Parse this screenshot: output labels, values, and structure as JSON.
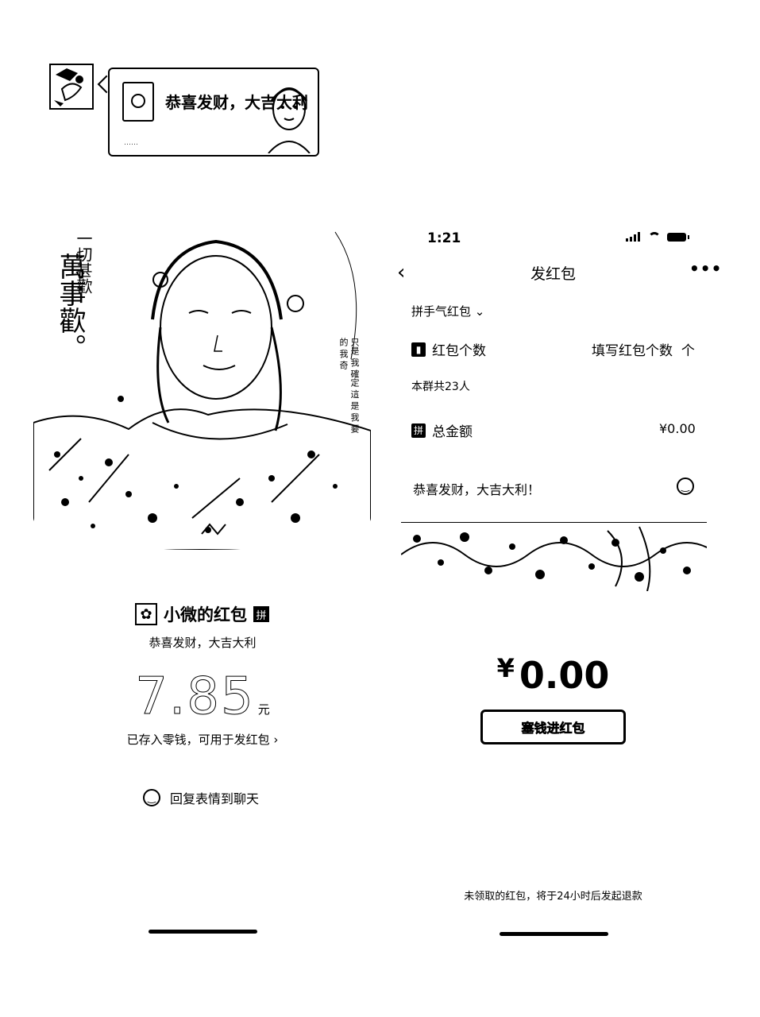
{
  "chat": {
    "bubble_title": "恭喜发财，大吉大利",
    "bubble_footer": "……"
  },
  "detail": {
    "cover_calligraphy": "萬事歡。",
    "cover_calligraphy_small": "一切甚歡",
    "cover_vertical_text": "只是 我 確定 這 是 我 要 的 我 奇",
    "sender_name": "小微的红包",
    "pin_badge": "拼",
    "greeting": "恭喜发财，大吉大利",
    "amount": "7.85",
    "amount_unit": "元",
    "stored_note": "已存入零钱，可用于发红包 ›",
    "reply_label": "回复表情到聊天"
  },
  "send": {
    "status_time": "1:21",
    "nav_back": "‹",
    "nav_title": "发红包",
    "nav_more": "•••",
    "type_select": "拼手气红包 ⌄",
    "count_label": "红包个数",
    "count_placeholder": "填写红包个数",
    "count_unit": "个",
    "group_size": "本群共23人",
    "total_icon": "拼",
    "total_label": "总金额",
    "total_value": "¥0.00",
    "greeting_value": "恭喜发财，大吉大利！",
    "amount_yen": "¥",
    "amount_value": "0.00",
    "send_button": "塞钱进红包",
    "refund_note": "未领取的红包，将于24小时后发起退款"
  }
}
